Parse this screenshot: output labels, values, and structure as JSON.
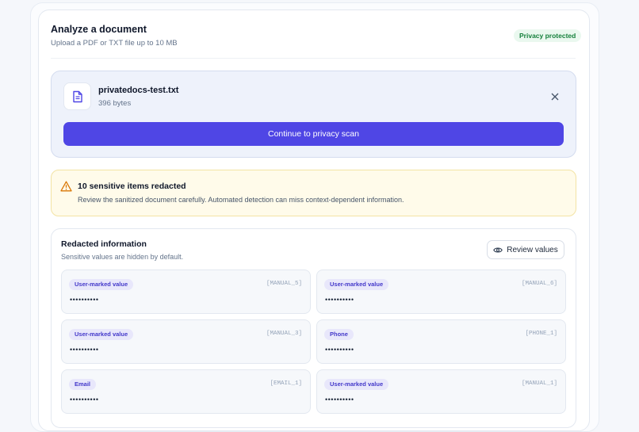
{
  "header": {
    "title": "Analyze a document",
    "subtitle": "Upload a PDF or TXT file up to 10 MB",
    "badge": "Privacy protected"
  },
  "file": {
    "name": "privatedocs-test.txt",
    "size": "396 bytes",
    "icon": "document-icon",
    "close_icon": "close-icon",
    "continue_label": "Continue to privacy scan"
  },
  "warning": {
    "icon": "warning-triangle-icon",
    "title": "10 sensitive items redacted",
    "text": "Review the sanitized document carefully. Automated detection can miss context-dependent information."
  },
  "redacted": {
    "title": "Redacted information",
    "subtitle": "Sensitive values are hidden by default.",
    "review_label": "Review values",
    "review_icon": "eye-icon",
    "items": [
      {
        "type": "User-marked value",
        "code": "[MANUAL_5]",
        "mask": "••••••••••"
      },
      {
        "type": "User-marked value",
        "code": "[MANUAL_6]",
        "mask": "••••••••••"
      },
      {
        "type": "User-marked value",
        "code": "[MANUAL_3]",
        "mask": "••••••••••"
      },
      {
        "type": "Phone",
        "code": "[PHONE_1]",
        "mask": "••••••••••"
      },
      {
        "type": "Email",
        "code": "[EMAIL_1]",
        "mask": "••••••••••"
      },
      {
        "type": "User-marked value",
        "code": "[MANUAL_1]",
        "mask": "••••••••••"
      }
    ]
  },
  "colors": {
    "accent": "#4f46e5",
    "badge_green": "#16803c",
    "warning_bg": "#fffbea",
    "warning_icon": "#d97706",
    "tag_text": "#4338ca"
  }
}
